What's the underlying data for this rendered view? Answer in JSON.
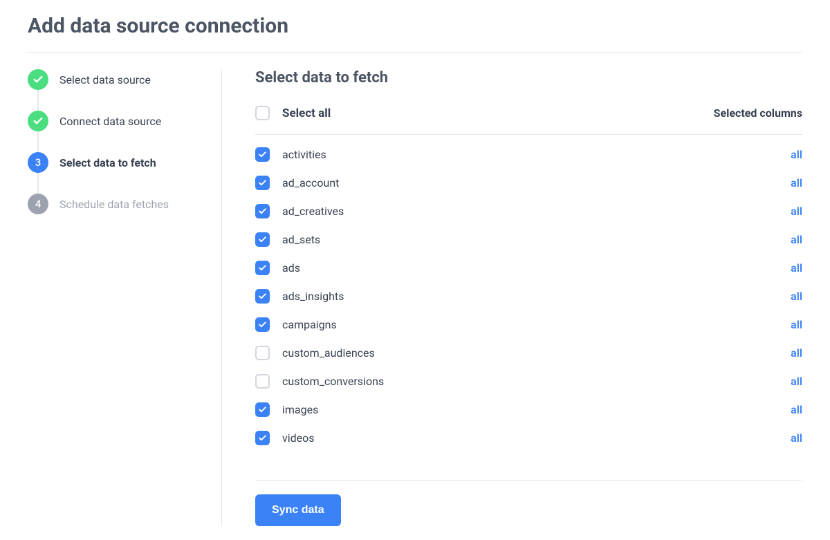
{
  "page_title": "Add data source connection",
  "steps": [
    {
      "label": "Select data source",
      "status": "completed",
      "number": "1"
    },
    {
      "label": "Connect data source",
      "status": "completed",
      "number": "2"
    },
    {
      "label": "Select data to fetch",
      "status": "active",
      "number": "3"
    },
    {
      "label": "Schedule data fetches",
      "status": "upcoming",
      "number": "4"
    }
  ],
  "section": {
    "title": "Select data to fetch",
    "select_all_label": "Select all",
    "select_all_checked": false,
    "selected_columns_header": "Selected columns",
    "all_link_text": "all",
    "items": [
      {
        "label": "activities",
        "checked": true
      },
      {
        "label": "ad_account",
        "checked": true
      },
      {
        "label": "ad_creatives",
        "checked": true
      },
      {
        "label": "ad_sets",
        "checked": true
      },
      {
        "label": "ads",
        "checked": true
      },
      {
        "label": "ads_insights",
        "checked": true
      },
      {
        "label": "campaigns",
        "checked": true
      },
      {
        "label": "custom_audiences",
        "checked": false
      },
      {
        "label": "custom_conversions",
        "checked": false
      },
      {
        "label": "images",
        "checked": true
      },
      {
        "label": "videos",
        "checked": true
      }
    ]
  },
  "sync_button_label": "Sync data"
}
